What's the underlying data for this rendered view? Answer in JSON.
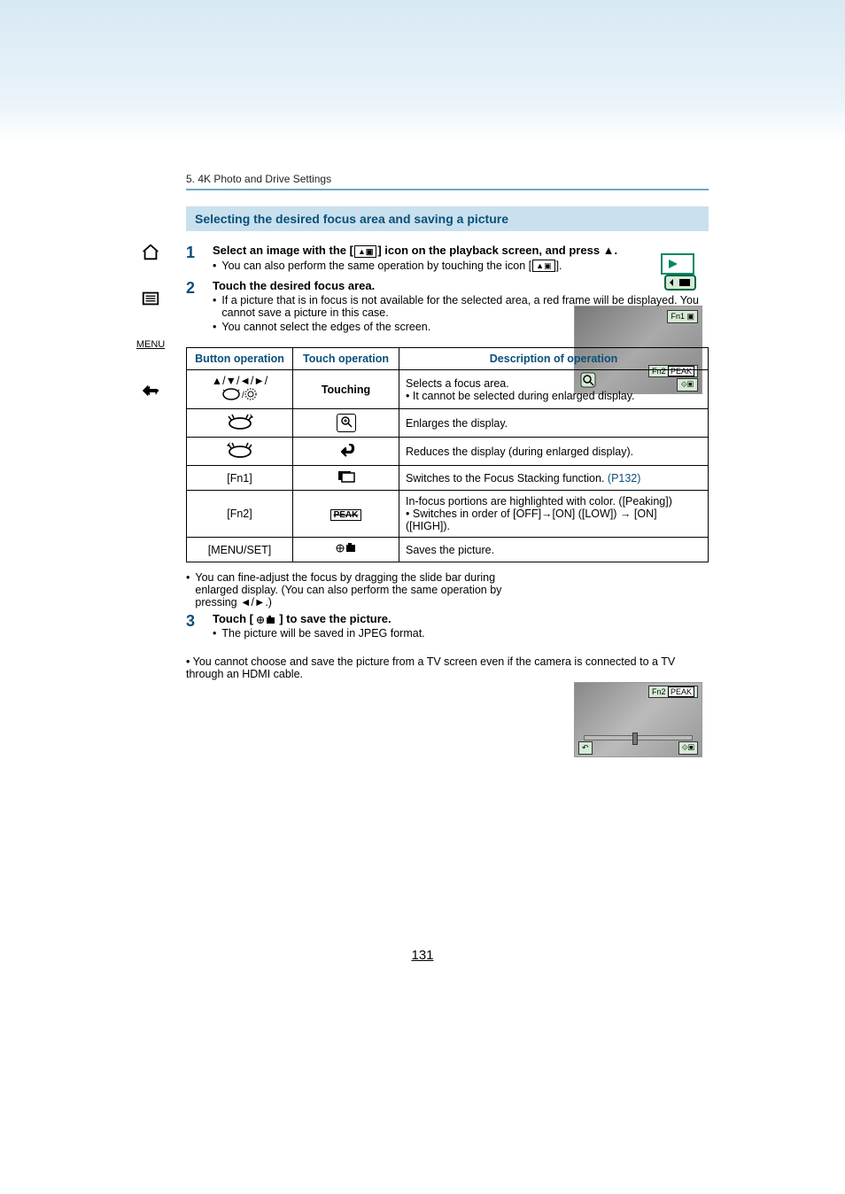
{
  "breadcrumb": "5. 4K Photo and Drive Settings",
  "section_heading": "Selecting the desired focus area and saving a picture",
  "steps": {
    "s1": {
      "num": "1",
      "title_pre": "Select an image with the [",
      "title_post": "] icon on the playback screen, and press ▲.",
      "b1": "You can also perform the same operation by touching the icon [",
      "b1_post": "]."
    },
    "s2": {
      "num": "2",
      "title": "Touch the desired focus area.",
      "b1": "If a picture that is in focus is not available for the selected area, a red frame will be displayed. You cannot save a picture in this case.",
      "b2": "You cannot select the edges of the screen."
    },
    "s3": {
      "num": "3",
      "title_pre": "Touch [ ",
      "title_post": " ] to save the picture.",
      "b1": "The picture will be saved in JPEG format."
    }
  },
  "table": {
    "headers": {
      "h1": "Button operation",
      "h2": "Touch operation",
      "h3": "Description of operation"
    },
    "rows": [
      {
        "btn": "▲/▼/◄/►/",
        "btn2": "dial",
        "touch": "Touching",
        "desc": "Selects a focus area.",
        "desc_b": "It cannot be selected during enlarged display."
      },
      {
        "btn": "zoom-in",
        "touch": "magnify",
        "desc": "Enlarges the display."
      },
      {
        "btn": "zoom-out",
        "touch": "back-arrow",
        "desc": "Reduces the display (during enlarged display)."
      },
      {
        "btn": "[Fn1]",
        "touch": "stack-icon",
        "desc": "Switches to the Focus Stacking function.",
        "link": "(P132)"
      },
      {
        "btn": "[Fn2]",
        "touch": "PEAK",
        "desc": "In-focus portions are highlighted with color. ([Peaking])",
        "desc_b": "Switches in order of [OFF]→[ON] ([LOW]) → [ON] ([HIGH])."
      },
      {
        "btn": "[MENU/SET]",
        "touch": "save-icon",
        "desc": "Saves the picture."
      }
    ]
  },
  "note": "You can fine-adjust the focus by dragging the slide bar during enlarged display. (You can also perform the same operation by pressing ◄/►.)",
  "footnote": "You cannot choose and save the picture from a TV screen even if the camera is connected to a TV through an HDMI cable.",
  "thumb_labels": {
    "fn1": "Fn1",
    "fn2": "Fn2",
    "peak": "PEAK"
  },
  "pagenum": "131",
  "sidenav": {
    "menu_label": "MENU"
  }
}
